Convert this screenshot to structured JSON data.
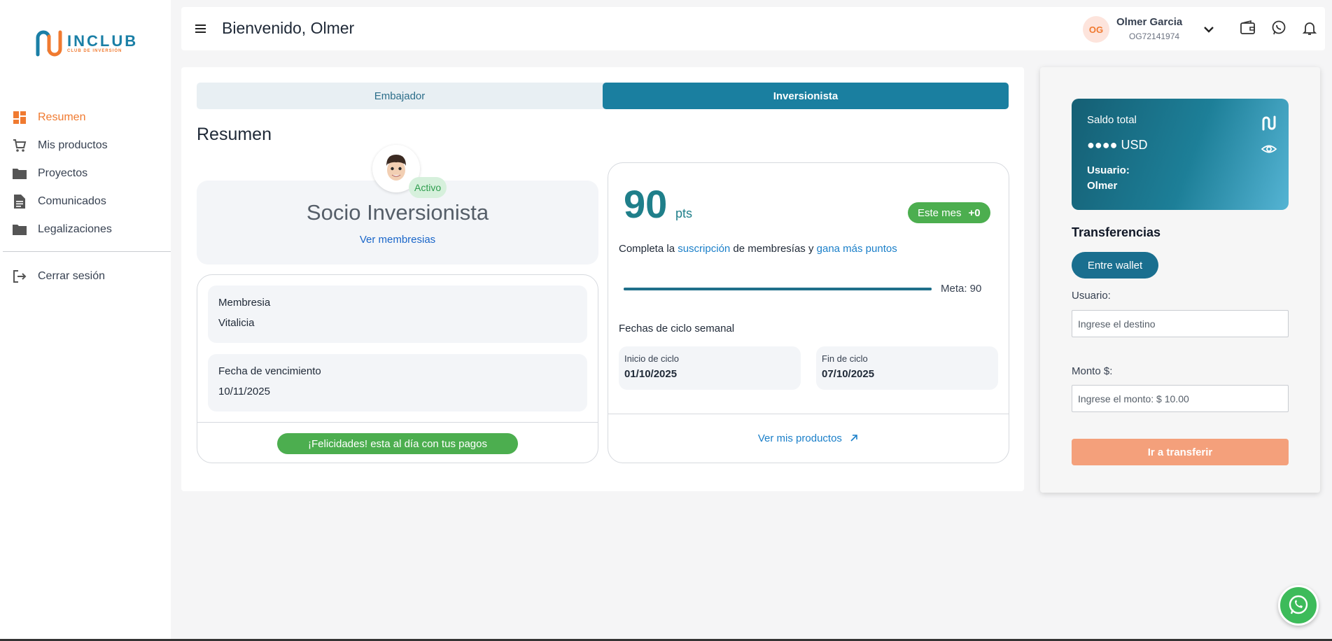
{
  "brand": {
    "name": "INCLUB",
    "tagline": "CLUB DE INVERSIÓN",
    "primary": "#1a7fa6",
    "accent": "#f07a30"
  },
  "sidebar": {
    "items": [
      {
        "label": "Resumen",
        "icon": "dashboard-icon",
        "active": true
      },
      {
        "label": "Mis productos",
        "icon": "cart-icon"
      },
      {
        "label": "Proyectos",
        "icon": "folder-icon"
      },
      {
        "label": "Comunicados",
        "icon": "document-icon"
      },
      {
        "label": "Legalizaciones",
        "icon": "folder-icon"
      }
    ],
    "logout": "Cerrar sesión"
  },
  "header": {
    "welcome": "Bienvenido, Olmer",
    "user": {
      "initials": "OG",
      "name": "Olmer Garcia",
      "id": "OG72141974"
    }
  },
  "main": {
    "tabs": [
      {
        "label": "Embajador",
        "active": false
      },
      {
        "label": "Inversionista",
        "active": true
      }
    ],
    "title": "Resumen",
    "membership": {
      "status": "Activo",
      "title": "Socio Inversionista",
      "link": "Ver membresias",
      "fields": [
        {
          "label": "Membresia",
          "value": "Vitalicia"
        },
        {
          "label": "Fecha de vencimiento",
          "value": "10/11/2025"
        }
      ],
      "paid_badge": "¡Felicidades! esta al día con tus pagos"
    },
    "points": {
      "value": "90",
      "unit": "pts",
      "month_label": "Este mes",
      "month_value": "+0",
      "text_1": "Completa la ",
      "link_1": "suscripción",
      "text_2": " de membresías y ",
      "link_2": "gana más puntos",
      "progress": 1.0,
      "goal": "Meta: 90",
      "cycle_title": "Fechas de ciclo semanal",
      "cycle_start_label": "Inicio de ciclo",
      "cycle_start": "01/10/2025",
      "cycle_end_label": "Fin de ciclo",
      "cycle_end": "07/10/2025",
      "products_link": "Ver mis productos"
    }
  },
  "wallet": {
    "balance_label": "Saldo total",
    "balance_value": "●●●● USD",
    "user_label": "Usuario:",
    "user": "Olmer",
    "transfer_title": "Transferencias",
    "wallet_button": "Entre wallet",
    "dest_label": "Usuario:",
    "dest_placeholder": "Ingrese el destino",
    "amount_label": "Monto $:",
    "amount_placeholder": "Ingrese el monto: $ 10.00",
    "submit": "Ir a transferir"
  }
}
